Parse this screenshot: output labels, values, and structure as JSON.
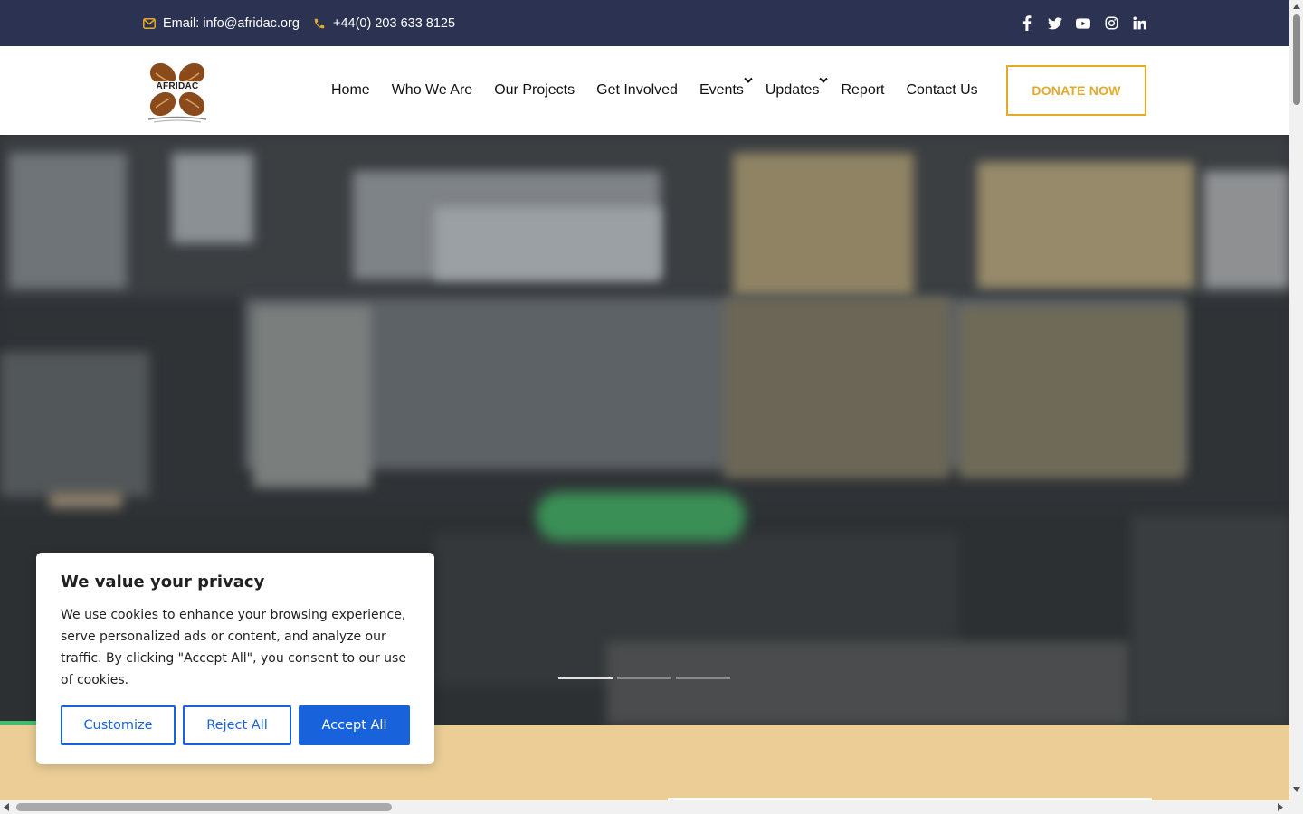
{
  "topbar": {
    "email_label": "Email: info@afridac.org",
    "phone_label": "+44(0) 203 633 8125",
    "socials": [
      "facebook-icon",
      "twitter-icon",
      "youtube-icon",
      "instagram-icon",
      "linkedin-icon"
    ]
  },
  "brand": {
    "logo_text": "AFRIDAC"
  },
  "nav": {
    "items": [
      {
        "label": "Home"
      },
      {
        "label": "Who We Are"
      },
      {
        "label": "Our Projects"
      },
      {
        "label": "Get Involved"
      },
      {
        "label": "Events",
        "dropdown": true
      },
      {
        "label": "Updates",
        "dropdown": true
      },
      {
        "label": "Report"
      },
      {
        "label": "Contact Us"
      }
    ],
    "donate_label": "DONATE NOW"
  },
  "hero": {
    "slides": 3,
    "active_slide": 1
  },
  "cookie": {
    "title": "We value your privacy",
    "body": "We use cookies to enhance your browsing experience, serve personalized ads or content, and analyze our traffic. By clicking \"Accept All\", you consent to our use of cookies.",
    "customize_label": "Customize",
    "reject_label": "Reject All",
    "accept_label": "Accept All"
  },
  "colors": {
    "topbar_bg": "#2b3252",
    "accent_gold": "#e6a92a",
    "beige": "#ebcd95",
    "cookie_blue": "#1863dc",
    "hero_green": "#3c9a5a"
  }
}
